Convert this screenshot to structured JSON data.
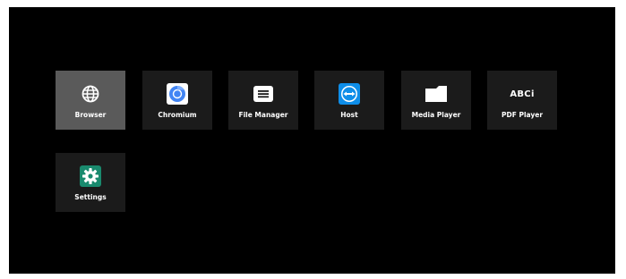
{
  "launcher": {
    "apps": [
      {
        "label": "Browser",
        "icon": "globe-icon",
        "selected": true
      },
      {
        "label": "Chromium",
        "icon": "chromium-icon",
        "selected": false
      },
      {
        "label": "File Manager",
        "icon": "file-manager-icon",
        "selected": false
      },
      {
        "label": "Host",
        "icon": "remote-host-icon",
        "selected": false
      },
      {
        "label": "Media Player",
        "icon": "folder-icon",
        "selected": false
      },
      {
        "label": "PDF Player",
        "icon": "abc-icon",
        "selected": false
      },
      {
        "label": "Settings",
        "icon": "gear-icon",
        "selected": false
      }
    ],
    "pdf_icon_text": "ABCi"
  },
  "colors": {
    "background": "#000000",
    "tile": "#1b1b1b",
    "tile_selected": "#5a5a5a",
    "chromium_blue": "#4285f4",
    "host_blue": "#0e8ee9",
    "settings_green": "#1a8a6e"
  }
}
